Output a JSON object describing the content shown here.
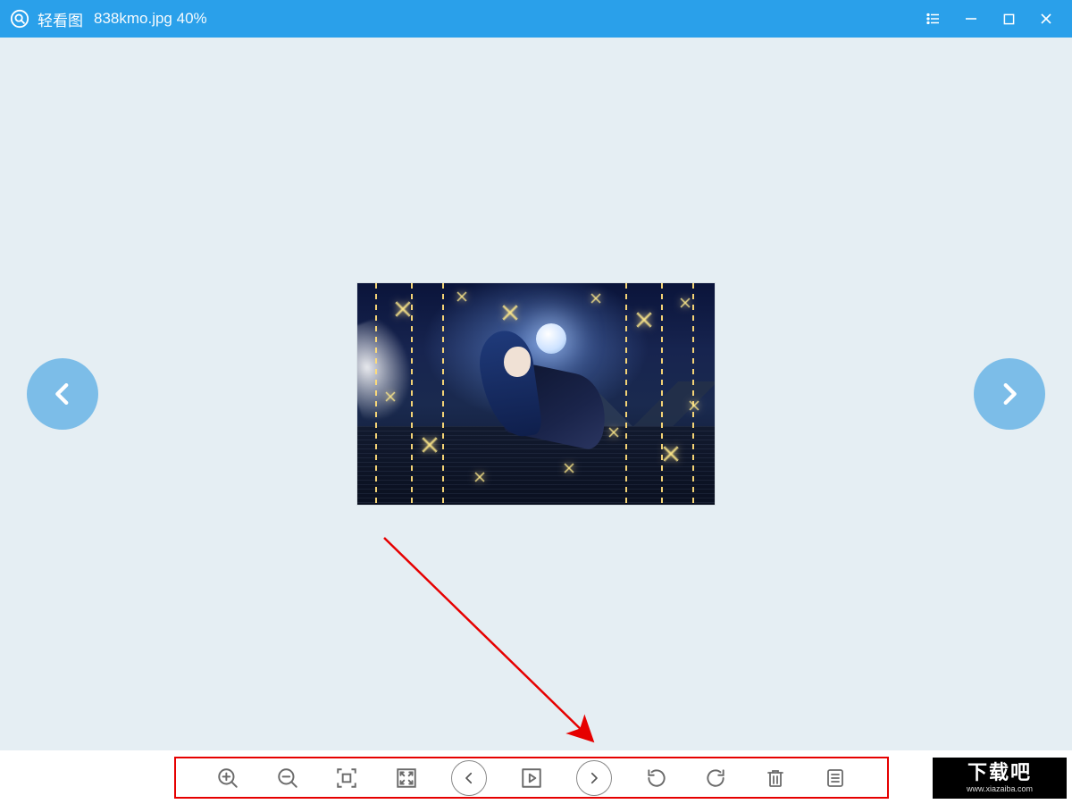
{
  "titlebar": {
    "app_name": "轻看图",
    "filename": "838kmo.jpg",
    "zoom": "40%"
  },
  "colors": {
    "accent": "#2aa0ea",
    "nav_circle": "#7cbde8",
    "annotation_red": "#e60000",
    "canvas_bg": "#e5eef3"
  },
  "nav": {
    "prev": "previous-image",
    "next": "next-image"
  },
  "window_controls": {
    "menu": "list-menu",
    "min": "minimize",
    "max": "maximize",
    "close": "close"
  },
  "toolbar": {
    "zoom_in": "zoom-in",
    "zoom_out": "zoom-out",
    "actual_size": "actual-size",
    "fullscreen": "fullscreen",
    "prev": "previous",
    "play": "slideshow",
    "next": "next",
    "rotate_ccw": "rotate-left",
    "rotate_cw": "rotate-right",
    "delete": "delete",
    "more": "more"
  },
  "watermark": {
    "text": "下载吧",
    "url": "www.xiazaiba.com"
  }
}
